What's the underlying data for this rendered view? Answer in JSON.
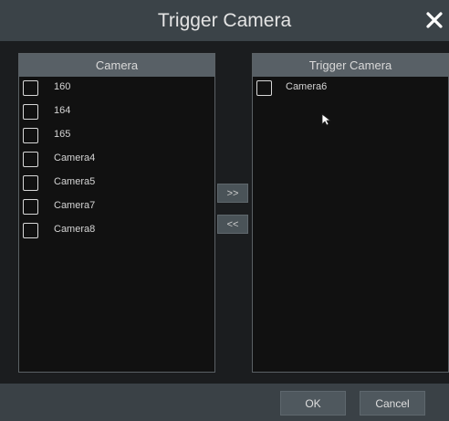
{
  "dialog": {
    "title": "Trigger Camera",
    "close_icon": "close-icon"
  },
  "left_panel": {
    "header": "Camera",
    "items": [
      {
        "label": "160",
        "checked": false
      },
      {
        "label": "164",
        "checked": false
      },
      {
        "label": "165",
        "checked": false
      },
      {
        "label": "Camera4",
        "checked": false
      },
      {
        "label": "Camera5",
        "checked": false
      },
      {
        "label": "Camera7",
        "checked": false
      },
      {
        "label": "Camera8",
        "checked": false
      }
    ]
  },
  "right_panel": {
    "header": "Trigger Camera",
    "items": [
      {
        "label": "Camera6",
        "checked": false
      }
    ]
  },
  "transfer": {
    "add_label": ">>",
    "remove_label": "<<"
  },
  "footer": {
    "ok_label": "OK",
    "cancel_label": "Cancel"
  },
  "colors": {
    "title_bar": "#3b4348",
    "panel_header": "#586066",
    "panel_background": "#111111",
    "footer": "#3a4146"
  }
}
